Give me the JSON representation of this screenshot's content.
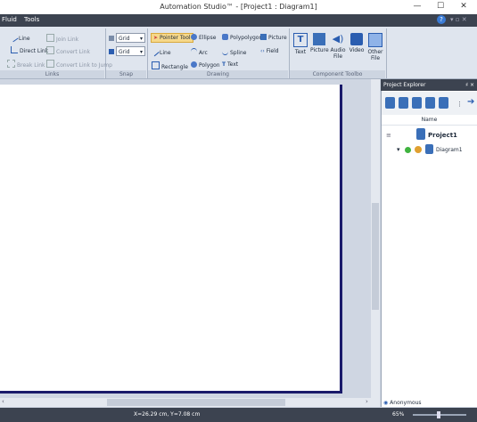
{
  "app": {
    "title": "Automation Studio™ - [Project1 : Diagram1]"
  },
  "menu": [
    "Fluid",
    "Tools"
  ],
  "ribbon": {
    "links": {
      "label": "Links",
      "items": [
        {
          "label": "Line",
          "enabled": true
        },
        {
          "label": "Join Link",
          "enabled": false
        },
        {
          "label": "Direct Link",
          "enabled": true
        },
        {
          "label": "Convert Link",
          "enabled": false
        },
        {
          "label": "Break Link",
          "enabled": false
        },
        {
          "label": "Convert Link to Jump",
          "enabled": false
        }
      ]
    },
    "snap": {
      "label": "Snap",
      "grid1": "Grid",
      "grid2": "Grid"
    },
    "drawing": {
      "label": "Drawing",
      "items": [
        "Pointer Tool",
        "Ellipse",
        "Polypolygon",
        "Picture",
        "Line",
        "Arc",
        "Spline",
        "Field",
        "Rectangle",
        "Polygon",
        "Text"
      ]
    },
    "component_toolbox": {
      "label": "Component Toolbo",
      "items": [
        "Text",
        "Picture",
        "Audio File",
        "Video",
        "Other File"
      ]
    }
  },
  "explorer": {
    "title": "Project Explorer",
    "pin": "♯ × ",
    "column_header": "Name",
    "project": "Project1",
    "diagram": "Diagram1"
  },
  "status": {
    "coords": "X=26.29 cm, Y=7.08 cm",
    "user": "Anonymous",
    "zoom": "65%"
  },
  "colors": {
    "accent": "#3c4350",
    "sheet_border": "#1a1a6a"
  }
}
